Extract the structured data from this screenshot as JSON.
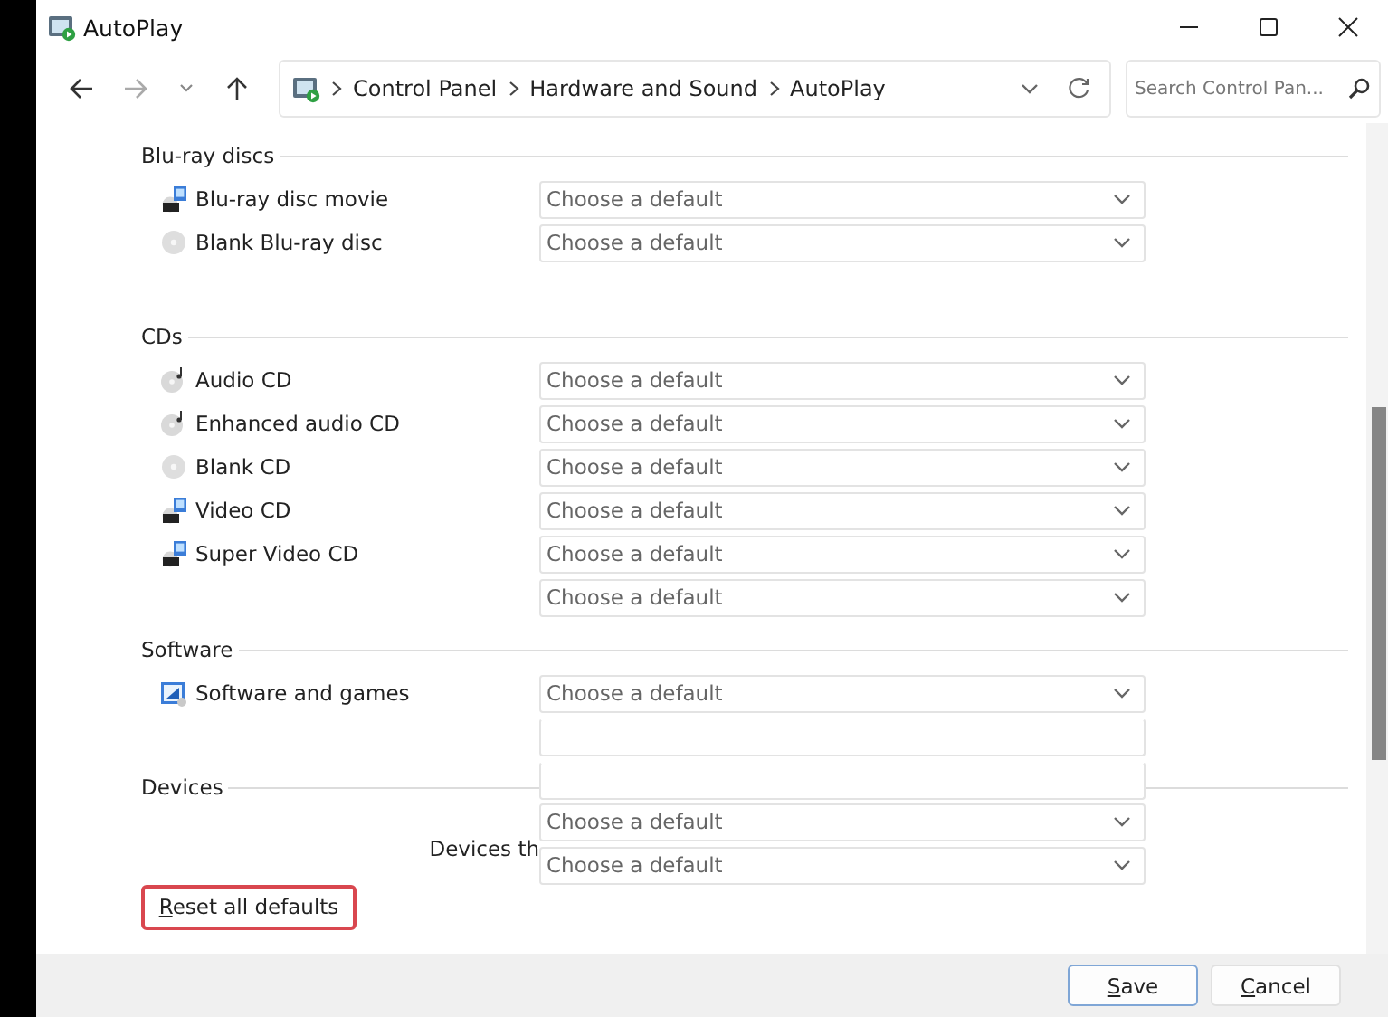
{
  "window": {
    "title": "AutoPlay"
  },
  "navigation": {
    "back_enabled": true,
    "forward_enabled": false
  },
  "breadcrumbs": [
    "Control Panel",
    "Hardware and Sound",
    "AutoPlay"
  ],
  "search": {
    "placeholder": "Search Control Pan..."
  },
  "sections": [
    {
      "title": "Blu-ray discs",
      "items": [
        {
          "kind": "item",
          "label": "Blu-ray disc movie",
          "value": "Choose a default"
        },
        {
          "kind": "item",
          "label": "Blank Blu-ray disc",
          "value": "Choose a default"
        }
      ]
    },
    {
      "title": "CDs",
      "items": [
        {
          "kind": "item",
          "label": "Audio CD",
          "value": "Choose a default"
        },
        {
          "kind": "item",
          "label": "Enhanced audio CD",
          "value": "Choose a default"
        },
        {
          "kind": "item",
          "label": "Blank CD",
          "value": "Choose a default"
        },
        {
          "kind": "item",
          "label": "Video CD",
          "value": "Choose a default"
        },
        {
          "kind": "item",
          "label": "Super Video CD",
          "value": "Choose a default"
        },
        {
          "kind": "dropdown",
          "value": "Choose a default"
        }
      ]
    },
    {
      "title": "Software",
      "items": [
        {
          "kind": "item",
          "label": "Software and games",
          "value": "Choose a default"
        },
        {
          "kind": "blank"
        }
      ]
    },
    {
      "title": "Devices",
      "title_control": {
        "kind": "blank"
      },
      "items": [
        {
          "kind": "dropdown",
          "value": "Choose a default"
        },
        {
          "kind": "note",
          "note": "Devices th",
          "value": "Choose a default"
        }
      ]
    }
  ],
  "reset_button": {
    "label": "Reset all defaults"
  },
  "buttons": [
    {
      "label": "Save",
      "default": true
    },
    {
      "label": "Cancel",
      "default": false
    }
  ]
}
